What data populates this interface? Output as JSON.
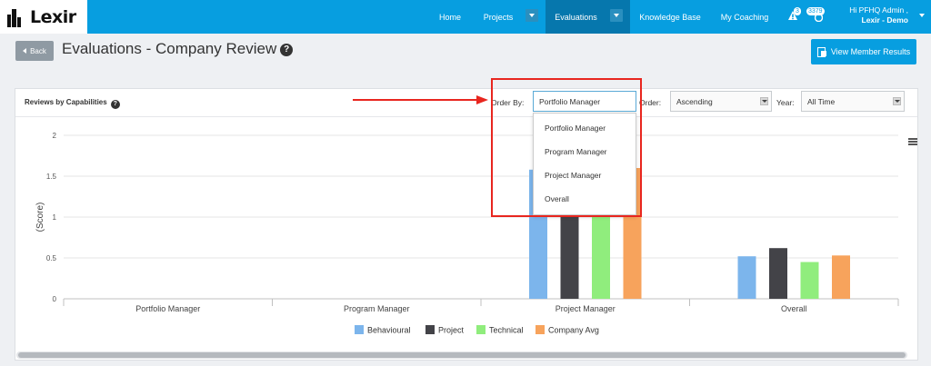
{
  "app": {
    "logo_text": "Lexir"
  },
  "nav": {
    "items": [
      {
        "label": "Home"
      },
      {
        "label": "Projects"
      },
      {
        "label": "Evaluations"
      },
      {
        "label": "Knowledge Base"
      },
      {
        "label": "My Coaching"
      }
    ],
    "alerts_count": "3",
    "points_count": "3379",
    "user_greeting": "Hi PFHQ Admin ,",
    "user_org": "Lexir - Demo"
  },
  "header": {
    "back_label": "Back",
    "title": "Evaluations - Company Review",
    "view_results_label": "View Member Results"
  },
  "panel": {
    "title": "Reviews by Capabilities",
    "order_by_label": "Order By:",
    "order_by_value": "Portfolio Manager",
    "order_label": "Order:",
    "order_value": "Ascending",
    "year_label": "Year:",
    "year_value": "All Time",
    "order_by_options": [
      "Portfolio Manager",
      "Program Manager",
      "Project Manager",
      "Overall"
    ]
  },
  "colors": {
    "nav_bg": "#079ee0",
    "nav_active": "#0677ad",
    "annotation": "#e8261f"
  },
  "chart_data": {
    "type": "bar",
    "title": "",
    "ylabel": "(Score)",
    "xlabel": "",
    "ylim": [
      0,
      2
    ],
    "yticks": [
      "0",
      "0.5",
      "1",
      "1.5",
      "2"
    ],
    "categories": [
      "Portfolio Manager",
      "Program Manager",
      "Project Manager",
      "Overall"
    ],
    "series": [
      {
        "name": "Behavioural",
        "color": "#7cb5ec",
        "values": [
          0,
          0,
          1.58,
          0.52
        ]
      },
      {
        "name": "Project",
        "color": "#434348",
        "values": [
          0,
          0,
          1.6,
          0.62
        ]
      },
      {
        "name": "Technical",
        "color": "#90ed7d",
        "values": [
          0,
          0,
          1.6,
          0.45
        ]
      },
      {
        "name": "Company Avg",
        "color": "#f7a35c",
        "values": [
          0,
          0,
          1.6,
          0.53
        ]
      }
    ],
    "legend_position": "bottom-center",
    "grid": true
  }
}
